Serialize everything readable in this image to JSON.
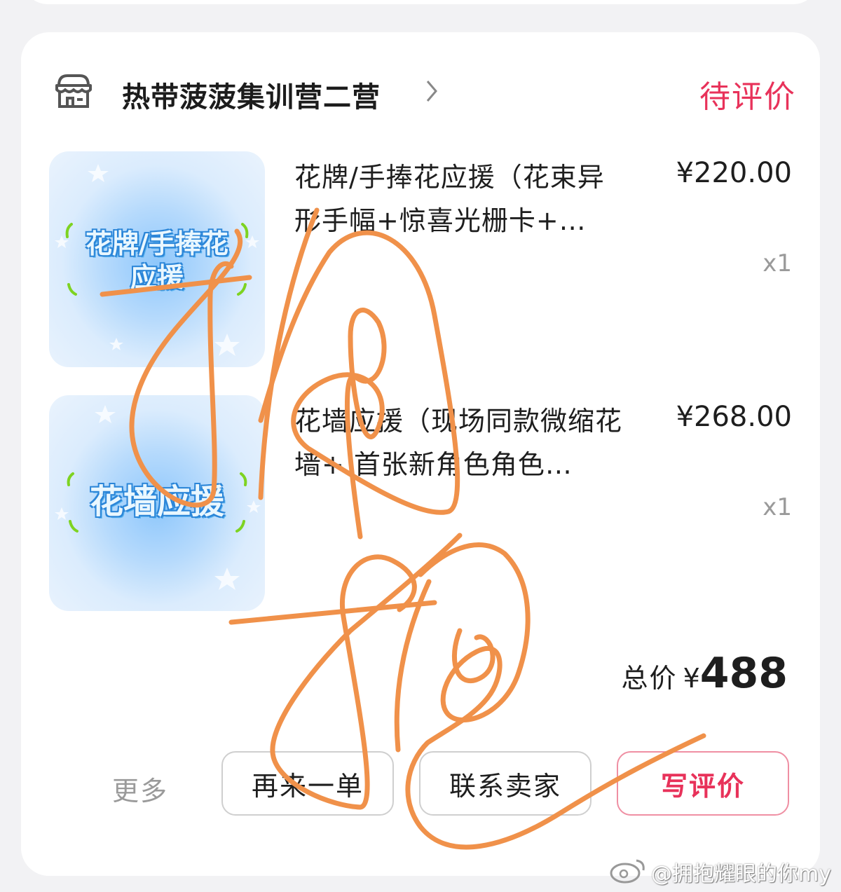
{
  "store": {
    "name": "热带菠菠集训营二营",
    "icon": "store-icon",
    "status": "待评价"
  },
  "items": [
    {
      "thumbnail_text": "花牌/手捧花\n应援",
      "title": "花牌/手捧花应援（花束异形手幅+惊喜光栅卡+…",
      "price": "¥220.00",
      "quantity": "x1"
    },
    {
      "thumbnail_text": "花墙应援",
      "title": "花墙应援（现场同款微缩花墙+ 首张新角色角色…",
      "price": "¥268.00",
      "quantity": "x1"
    }
  ],
  "total": {
    "label": "总价",
    "currency": "¥",
    "amount": "488"
  },
  "actions": {
    "more": "更多",
    "reorder": "再来一单",
    "contact": "联系卖家",
    "review": "写评价"
  },
  "watermark": "@拥抱耀眼的你my",
  "colors": {
    "accent": "#e8325a",
    "scribble": "#f0914a",
    "thumbnail_blue": "#8ec7fb"
  }
}
